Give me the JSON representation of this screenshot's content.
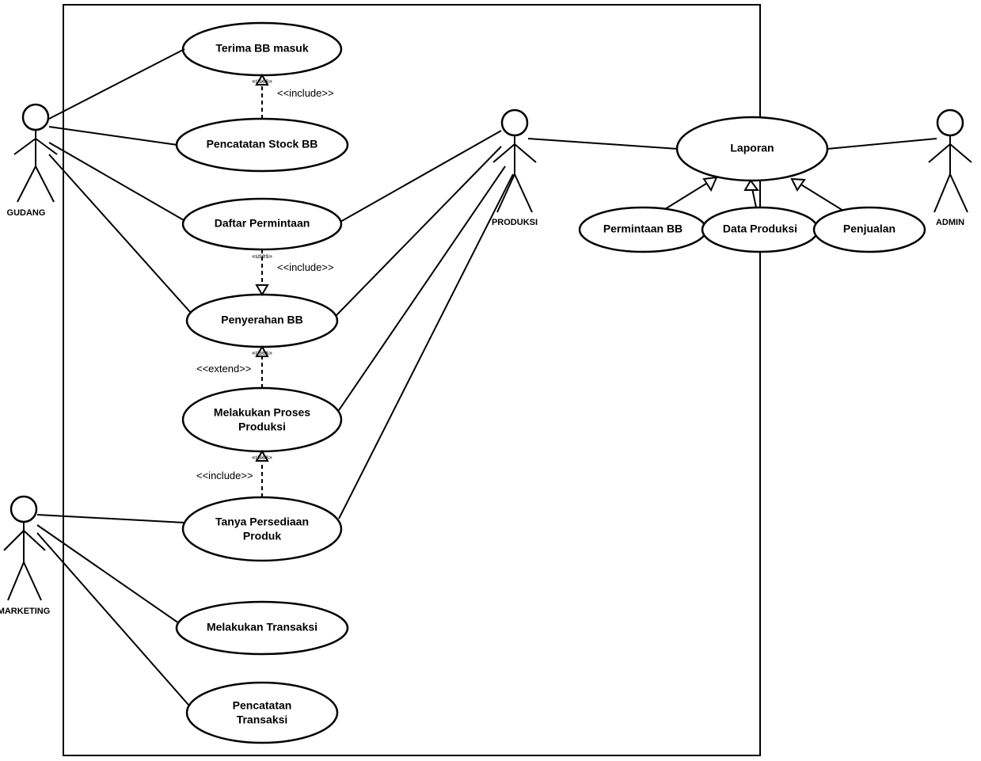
{
  "actors": {
    "gudang": "GUDANG",
    "produksi": "PRODUKSI",
    "marketing": "MARKETING",
    "admin": "ADMIN"
  },
  "usecases": {
    "terima_bb_masuk": "Terima BB masuk",
    "pencatatan_stock_bb": "Pencatatan Stock BB",
    "daftar_permintaan": "Daftar Permintaan",
    "penyerahan_bb": "Penyerahan BB",
    "melakukan_proses_l1": "Melakukan Proses",
    "melakukan_proses_l2": "Produksi",
    "tanya_persediaan_l1": "Tanya Persediaan",
    "tanya_persediaan_l2": "Produk",
    "melakukan_transaksi": "Melakukan Transaksi",
    "pencatatan_transaksi_l1": "Pencatatan",
    "pencatatan_transaksi_l2": "Transaksi",
    "laporan": "Laporan",
    "permintaan_bb": "Permintaan BB",
    "data_produksi": "Data Produksi",
    "penjualan": "Penjualan"
  },
  "relations": {
    "include": "<<include>>",
    "extend": "<<extend>>",
    "uses": "«uses»"
  }
}
